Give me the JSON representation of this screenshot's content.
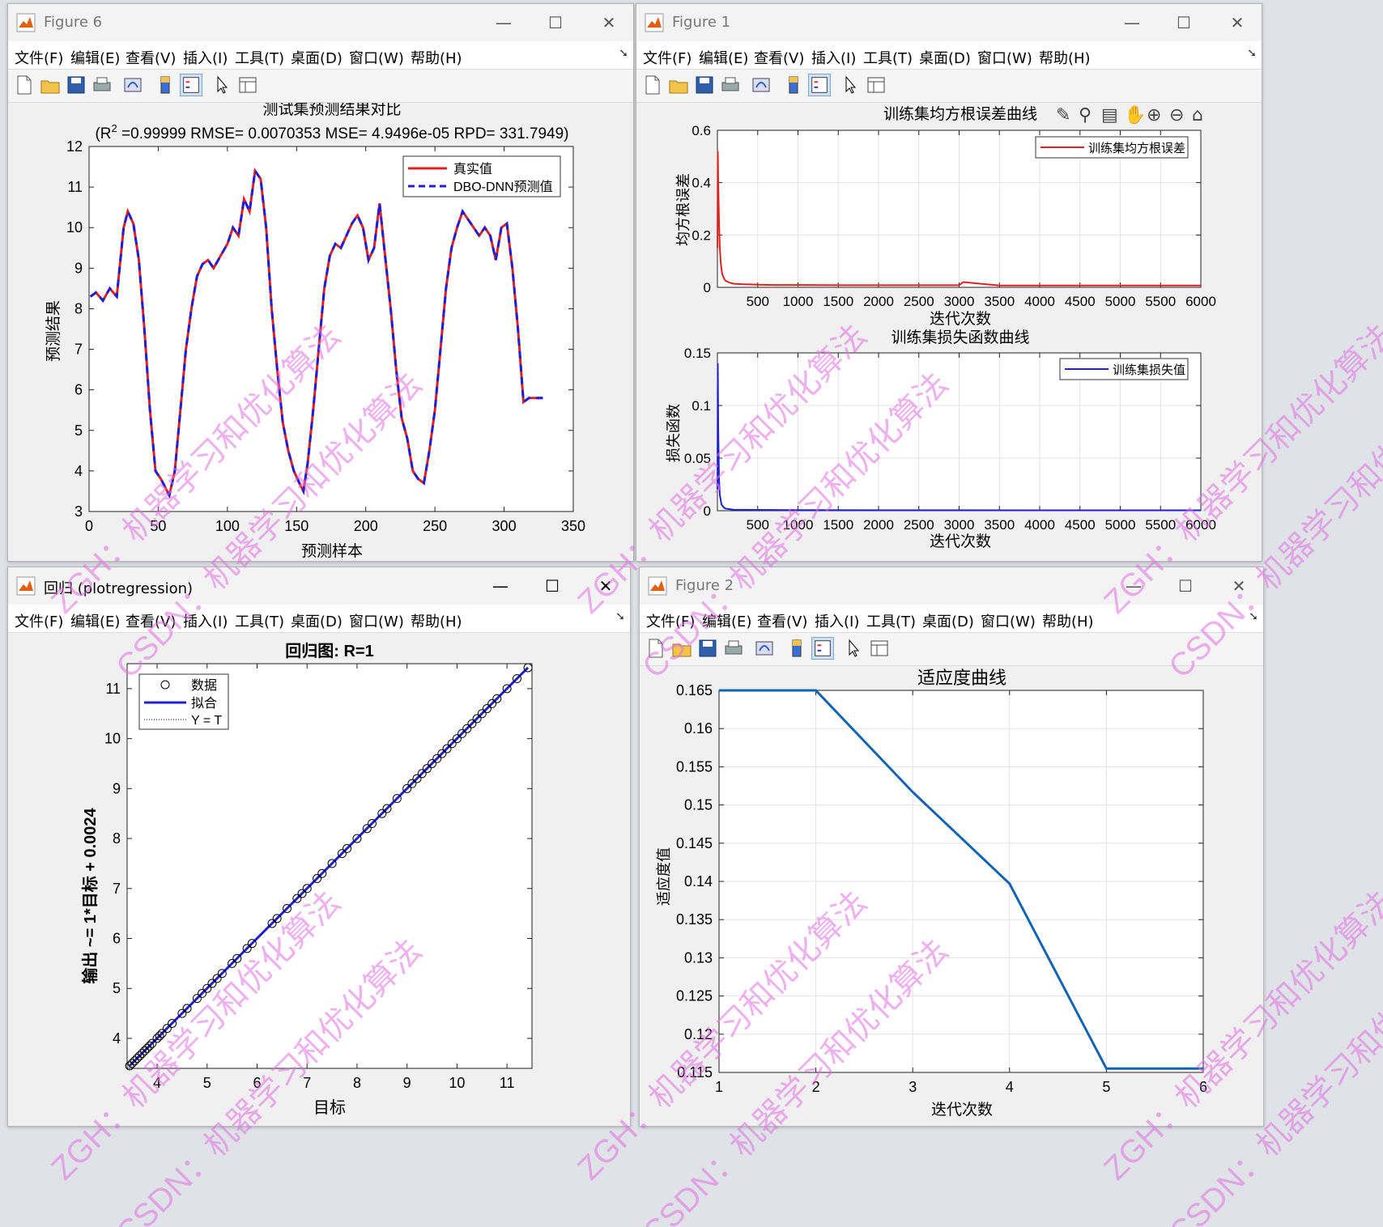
{
  "menus": [
    "文件(F)",
    "编辑(E)",
    "查看(V)",
    "插入(I)",
    "工具(T)",
    "桌面(D)",
    "窗口(W)",
    "帮助(H)"
  ],
  "colors": {
    "true_line": "#e0201f",
    "pred_line": "#1f1fd6",
    "rmse_line": "#e0201f",
    "loss_line": "#1f1fd6",
    "fit_line": "#1064b2",
    "regress_line": "#1f1fd6",
    "watermark": "#e070e0"
  },
  "toolbar_icons": [
    "new-figure-icon",
    "open-file-icon",
    "save-icon",
    "print-icon",
    "link-plot-icon",
    "insert-colorbar-icon",
    "insert-legend-icon",
    "select-arrow-icon",
    "property-inspector-icon"
  ],
  "axes_toolbar_icons": [
    "brush-icon",
    "data-tips-icon",
    "restore-view-icon",
    "pan-icon",
    "zoom-in-icon",
    "zoom-out-icon",
    "home-icon"
  ],
  "window_controls": {
    "minimize": "—",
    "maximize": "☐",
    "close": "✕"
  },
  "figures": {
    "fig6": {
      "title": "Figure 6",
      "plot_title": "测试集预测结果对比",
      "plot_subtitle_pre": "(R",
      "plot_subtitle_sup": "2",
      "plot_subtitle_post": " =0.99999 RMSE= 0.0070353 MSE= 4.9496e-05 RPD= 331.7949)",
      "xlabel": "预测样本",
      "ylabel": "预测结果",
      "legend": [
        "真实值",
        "DBO-DNN预测值"
      ]
    },
    "fig1": {
      "title": "Figure 1",
      "top": {
        "title": "训练集均方根误差曲线",
        "ylabel": "均方根误差",
        "xlabel": "迭代次数",
        "legend": "训练集均方根误差"
      },
      "bottom": {
        "title": "训练集损失函数曲线",
        "ylabel": "损失函数",
        "xlabel": "迭代次数",
        "legend": "训练集损失值"
      }
    },
    "reg": {
      "title": "回归 (plotregression)",
      "plot_title": "回归图: R=1",
      "xlabel": "目标",
      "ylabel": "输出 ~= 1*目标 + 0.0024",
      "legend": [
        "数据",
        "拟合",
        "Y = T"
      ]
    },
    "fig2": {
      "title": "Figure 2",
      "plot_title": "适应度曲线",
      "xlabel": "迭代次数",
      "ylabel": "适应度值"
    }
  },
  "watermark_lines": [
    "ZGH：机器学习和优化算法",
    "CSDN：机器学习和优化算法"
  ],
  "chart_data": [
    {
      "type": "line",
      "title": "测试集预测结果对比",
      "subtitle": "(R2 =0.99999 RMSE= 0.0070353 MSE= 4.9496e-05 RPD= 331.7949)",
      "xlabel": "预测样本",
      "ylabel": "预测结果",
      "xlim": [
        0,
        350
      ],
      "ylim": [
        3,
        12
      ],
      "xticks": [
        0,
        50,
        100,
        150,
        200,
        250,
        300,
        350
      ],
      "yticks": [
        3,
        4,
        5,
        6,
        7,
        8,
        9,
        10,
        11,
        12
      ],
      "legend_position": "top-right",
      "series": [
        {
          "name": "真实值",
          "style": "solid",
          "x": [
            1,
            5,
            10,
            15,
            20,
            25,
            28,
            32,
            36,
            40,
            44,
            48,
            52,
            55,
            58,
            62,
            66,
            70,
            74,
            78,
            82,
            86,
            90,
            95,
            100,
            104,
            108,
            112,
            116,
            120,
            124,
            128,
            132,
            136,
            140,
            144,
            148,
            152,
            155,
            158,
            162,
            166,
            170,
            174,
            178,
            182,
            186,
            190,
            194,
            198,
            202,
            206,
            210,
            214,
            218,
            222,
            226,
            230,
            234,
            238,
            242,
            246,
            250,
            254,
            258,
            262,
            266,
            270,
            274,
            278,
            282,
            286,
            290,
            294,
            298,
            302,
            306,
            310,
            314,
            318,
            322,
            326,
            328
          ],
          "values": [
            8.3,
            8.4,
            8.2,
            8.5,
            8.3,
            10.0,
            10.4,
            10.1,
            9.2,
            7.5,
            5.5,
            4.0,
            3.8,
            3.6,
            3.4,
            4.0,
            5.5,
            7.0,
            8.0,
            8.8,
            9.1,
            9.2,
            9.0,
            9.3,
            9.6,
            10.0,
            9.8,
            10.7,
            10.4,
            11.4,
            11.2,
            10.0,
            8.0,
            6.5,
            5.2,
            4.5,
            4.0,
            3.7,
            3.5,
            4.2,
            5.5,
            7.0,
            8.5,
            9.3,
            9.6,
            9.5,
            9.8,
            10.1,
            10.3,
            10.0,
            9.2,
            9.5,
            10.6,
            9.3,
            8.0,
            6.5,
            5.3,
            4.8,
            4.0,
            3.8,
            3.7,
            4.5,
            5.5,
            7.0,
            8.5,
            9.5,
            10.0,
            10.4,
            10.2,
            10.0,
            9.8,
            10.0,
            9.8,
            9.2,
            10.0,
            10.1,
            9.0,
            7.5,
            5.7,
            5.8,
            5.8,
            5.8,
            5.8
          ]
        },
        {
          "name": "DBO-DNN预测值",
          "style": "dashed",
          "x": [
            1,
            5,
            10,
            15,
            20,
            25,
            28,
            32,
            36,
            40,
            44,
            48,
            52,
            55,
            58,
            62,
            66,
            70,
            74,
            78,
            82,
            86,
            90,
            95,
            100,
            104,
            108,
            112,
            116,
            120,
            124,
            128,
            132,
            136,
            140,
            144,
            148,
            152,
            155,
            158,
            162,
            166,
            170,
            174,
            178,
            182,
            186,
            190,
            194,
            198,
            202,
            206,
            210,
            214,
            218,
            222,
            226,
            230,
            234,
            238,
            242,
            246,
            250,
            254,
            258,
            262,
            266,
            270,
            274,
            278,
            282,
            286,
            290,
            294,
            298,
            302,
            306,
            310,
            314,
            318,
            322,
            326,
            328
          ],
          "values": [
            8.3,
            8.4,
            8.2,
            8.5,
            8.3,
            10.0,
            10.4,
            10.1,
            9.2,
            7.5,
            5.5,
            4.0,
            3.8,
            3.6,
            3.4,
            4.0,
            5.5,
            7.0,
            8.0,
            8.8,
            9.1,
            9.2,
            9.0,
            9.3,
            9.6,
            10.0,
            9.8,
            10.7,
            10.4,
            11.4,
            11.2,
            10.0,
            8.0,
            6.5,
            5.2,
            4.5,
            4.0,
            3.7,
            3.5,
            4.2,
            5.5,
            7.0,
            8.5,
            9.3,
            9.6,
            9.5,
            9.8,
            10.1,
            10.3,
            10.0,
            9.2,
            9.5,
            10.6,
            9.3,
            8.0,
            6.5,
            5.3,
            4.8,
            4.0,
            3.8,
            3.7,
            4.5,
            5.5,
            7.0,
            8.5,
            9.5,
            10.0,
            10.4,
            10.2,
            10.0,
            9.8,
            10.0,
            9.8,
            9.2,
            10.0,
            10.1,
            9.0,
            7.5,
            5.7,
            5.8,
            5.8,
            5.8,
            5.8
          ]
        }
      ]
    },
    {
      "type": "line",
      "title": "训练集均方根误差曲线",
      "xlabel": "迭代次数",
      "ylabel": "均方根误差",
      "xlim": [
        0,
        6000
      ],
      "ylim": [
        0,
        0.6
      ],
      "xticks": [
        500,
        1000,
        1500,
        2000,
        2500,
        3000,
        3500,
        4000,
        4500,
        5000,
        5500,
        6000
      ],
      "yticks": [
        0,
        0.2,
        0.4,
        0.6
      ],
      "grid": true,
      "legend_position": "top-right",
      "series": [
        {
          "name": "训练集均方根误差",
          "x": [
            1,
            5,
            10,
            20,
            30,
            40,
            50,
            60,
            80,
            100,
            150,
            200,
            300,
            400,
            500,
            700,
            1000,
            1500,
            2000,
            2500,
            3000,
            3050,
            3500,
            4000,
            4500,
            5000,
            5500,
            6000
          ],
          "values": [
            0.15,
            0.52,
            0.4,
            0.25,
            0.15,
            0.1,
            0.07,
            0.05,
            0.035,
            0.025,
            0.018,
            0.014,
            0.012,
            0.011,
            0.01,
            0.009,
            0.009,
            0.008,
            0.008,
            0.008,
            0.008,
            0.02,
            0.007,
            0.007,
            0.007,
            0.007,
            0.007,
            0.007
          ]
        }
      ]
    },
    {
      "type": "line",
      "title": "训练集损失函数曲线",
      "xlabel": "迭代次数",
      "ylabel": "损失函数",
      "xlim": [
        0,
        6000
      ],
      "ylim": [
        0,
        0.15
      ],
      "xticks": [
        500,
        1000,
        1500,
        2000,
        2500,
        3000,
        3500,
        4000,
        4500,
        5000,
        5500,
        6000
      ],
      "yticks": [
        0,
        0.05,
        0.1,
        0.15
      ],
      "grid": true,
      "legend_position": "top-right",
      "series": [
        {
          "name": "训练集损失值",
          "x": [
            1,
            5,
            10,
            20,
            30,
            50,
            80,
            100,
            200,
            500,
            1000,
            2000,
            3000,
            4000,
            5000,
            6000
          ],
          "values": [
            0.02,
            0.14,
            0.08,
            0.03,
            0.015,
            0.006,
            0.003,
            0.002,
            0.001,
            0.0008,
            0.0006,
            0.0005,
            0.0005,
            0.0004,
            0.0004,
            0.0004
          ]
        }
      ]
    },
    {
      "type": "scatter",
      "title": "回归图: R=1",
      "xlabel": "目标",
      "ylabel": "输出 ~= 1*目标 + 0.0024",
      "xlim": [
        3.4,
        11.5
      ],
      "ylim": [
        3.4,
        11.5
      ],
      "xticks": [
        4,
        5,
        6,
        7,
        8,
        9,
        10,
        11
      ],
      "yticks": [
        4,
        5,
        6,
        7,
        8,
        9,
        10,
        11
      ],
      "legend_position": "top-left",
      "fit": {
        "slope": 1,
        "intercept": 0.0024
      },
      "points_x": [
        3.45,
        3.5,
        3.55,
        3.6,
        3.65,
        3.7,
        3.75,
        3.8,
        3.85,
        3.9,
        4.0,
        4.05,
        4.1,
        4.2,
        4.3,
        4.5,
        4.6,
        4.8,
        4.9,
        5.0,
        5.1,
        5.2,
        5.3,
        5.5,
        5.6,
        5.8,
        5.9,
        6.3,
        6.4,
        6.6,
        6.8,
        6.9,
        7.0,
        7.2,
        7.3,
        7.5,
        7.7,
        7.8,
        8.0,
        8.2,
        8.3,
        8.5,
        8.6,
        8.8,
        9.0,
        9.1,
        9.2,
        9.3,
        9.4,
        9.5,
        9.6,
        9.7,
        9.8,
        9.9,
        10.0,
        10.1,
        10.2,
        10.3,
        10.4,
        10.5,
        10.6,
        10.7,
        10.8,
        11.0,
        11.2,
        11.42
      ]
    },
    {
      "type": "line",
      "title": "适应度曲线",
      "xlabel": "迭代次数",
      "ylabel": "适应度值",
      "xlim": [
        1,
        6
      ],
      "ylim": [
        0.115,
        0.165
      ],
      "xticks": [
        1,
        2,
        3,
        4,
        5,
        6
      ],
      "yticks": [
        0.115,
        0.12,
        0.125,
        0.13,
        0.135,
        0.14,
        0.145,
        0.15,
        0.155,
        0.16,
        0.165
      ],
      "grid": true,
      "series": [
        {
          "x": [
            1,
            2,
            3,
            4,
            5,
            6
          ],
          "values": [
            0.165,
            0.165,
            0.1517,
            0.1397,
            0.1155,
            0.1155
          ]
        }
      ]
    }
  ]
}
